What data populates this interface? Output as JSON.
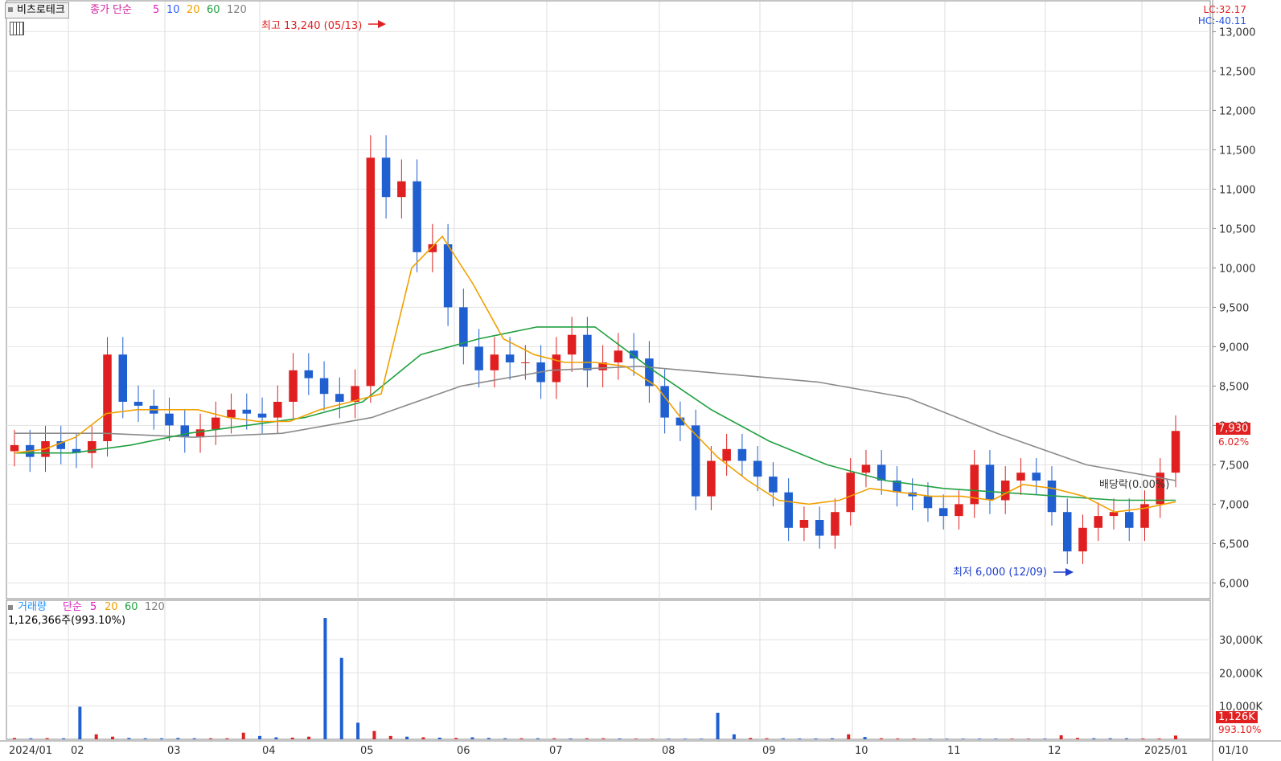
{
  "stock_name": "비츠로테크",
  "price_legend": {
    "label": "종가 단순",
    "periods": [
      "5",
      "10",
      "20",
      "60",
      "120"
    ],
    "colors": [
      "#e020c0",
      "#3060ff",
      "#f0a000",
      "#20a040",
      "#808080"
    ]
  },
  "volume_legend": {
    "label": "거래량",
    "method": "단순",
    "periods": [
      "5",
      "20",
      "60",
      "120"
    ]
  },
  "volume_readout": "1,126,366주(993.10%)",
  "top_right": {
    "lc": "LC:32.17",
    "hc": "HC:-40.11"
  },
  "max_annotation": "최고 13,240 (05/13)",
  "min_annotation": "최저 6,000 (12/09)",
  "dividend_annotation": "배당락(0.00%)",
  "last_price_badge": "7,930",
  "last_change": "6.02%",
  "last_volume_badge": "1,126K",
  "last_volume_pct": "993.10%",
  "chart_data": {
    "type": "candlestick",
    "x_ticks": [
      "2024/01",
      "02",
      "03",
      "04",
      "05",
      "06",
      "07",
      "08",
      "09",
      "10",
      "11",
      "12",
      "2025/01",
      "01/10"
    ],
    "price_axis": {
      "min": 5800,
      "max": 13300,
      "ticks": [
        6000,
        6500,
        7000,
        7500,
        8000,
        8500,
        9000,
        9500,
        10000,
        10500,
        11000,
        11500,
        12000,
        12500,
        13000
      ],
      "tick_labels": [
        "6,000",
        "6,500",
        "7,000",
        "7,500",
        "8,000",
        "8,500",
        "9,000",
        "9,500",
        "10,000",
        "10,500",
        "11,000",
        "11,500",
        "12,000",
        "12,500",
        "13,000"
      ]
    },
    "volume_axis": {
      "min": 0,
      "max": 37000,
      "ticks": [
        10000,
        20000,
        30000
      ],
      "tick_labels": [
        "10,000K",
        "20,000K",
        "30,000K"
      ]
    },
    "weekly_close": [
      7750,
      7600,
      7800,
      7700,
      7650,
      7800,
      8900,
      8300,
      8250,
      8150,
      8000,
      7850,
      7950,
      8100,
      8200,
      8150,
      8100,
      8300,
      8700,
      8600,
      8400,
      8300,
      8500,
      11400,
      10900,
      11100,
      10200,
      10300,
      9500,
      9000,
      8700,
      8900,
      8800,
      8800,
      8550,
      8900,
      9150,
      8700,
      8800,
      8950,
      8850,
      8500,
      8100,
      8000,
      7100,
      7550,
      7700,
      7550,
      7350,
      7150,
      6700,
      6800,
      6600,
      6900,
      7400,
      7500,
      7300,
      7150,
      7100,
      6950,
      6850,
      7000,
      7500,
      7050,
      7300,
      7400,
      7300,
      6900,
      6400,
      6700,
      6850,
      6900,
      6700,
      7000,
      7400,
      7930
    ],
    "weekly_volume_k": [
      400,
      300,
      350,
      300,
      9800,
      1500,
      800,
      400,
      300,
      300,
      400,
      300,
      300,
      300,
      2000,
      1000,
      600,
      500,
      800,
      36500,
      24500,
      5000,
      2500,
      1000,
      800,
      600,
      500,
      400,
      600,
      400,
      300,
      300,
      300,
      300,
      250,
      300,
      300,
      250,
      200,
      200,
      200,
      200,
      200,
      8000,
      1500,
      400,
      300,
      300,
      250,
      250,
      300,
      1500,
      700,
      300,
      250,
      250,
      200,
      200,
      200,
      200,
      200,
      200,
      200,
      200,
      1200,
      400,
      300,
      300,
      300,
      250,
      250,
      1126
    ],
    "ma_price": {
      "ma20": [
        7650,
        7700,
        7850,
        8150,
        8200,
        8200,
        8200,
        8100,
        8050,
        8050,
        8200,
        8300,
        8400,
        10000,
        10400,
        9800,
        9100,
        8900,
        8800,
        8800,
        8750,
        8500,
        8000,
        7600,
        7300,
        7050,
        7000,
        7050,
        7200,
        7150,
        7100,
        7100,
        7050,
        7250,
        7200,
        7100,
        6900,
        6950,
        7030
      ],
      "ma60": [
        7650,
        7650,
        7750,
        7900,
        8000,
        8100,
        8300,
        8900,
        9100,
        9250,
        9250,
        8700,
        8200,
        7800,
        7500,
        7300,
        7200,
        7150,
        7100,
        7050,
        7050
      ],
      "ma120": [
        7900,
        7900,
        7850,
        7900,
        8100,
        8500,
        8700,
        8750,
        8650,
        8550,
        8350,
        7900,
        7500,
        7300
      ]
    }
  }
}
